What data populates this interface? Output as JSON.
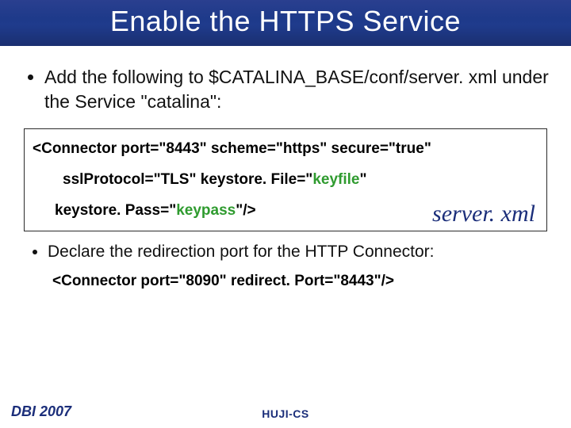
{
  "title": "Enable the HTTPS Service",
  "bullet1": "Add the following to $CATALINA_BASE/conf/server. xml under the Service \"catalina\":",
  "code1": {
    "line1_a": "<Connector port=\"8443\" scheme=\"https\" secure=\"true\"",
    "line2_pre": "sslProtocol=\"TLS\" keystore. File=\"",
    "line2_kf": "keyfile",
    "line2_post": "\"",
    "line3_pre": "keystore. Pass=\"",
    "line3_kp": "keypass",
    "line3_post": "\"/>",
    "badge": "server. xml"
  },
  "bullet2": "Declare the redirection port for the HTTP Connector:",
  "code2": "<Connector port=\"8090\" redirect. Port=\"8443\"/>",
  "footer": {
    "left": "DBI 2007",
    "center": "HUJI-CS"
  }
}
